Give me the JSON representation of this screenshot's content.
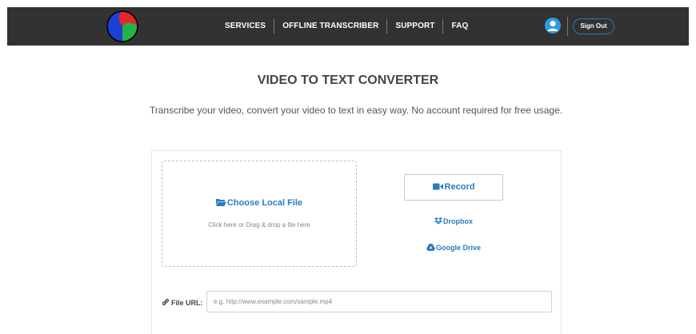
{
  "header": {
    "logo_icon": "tricolor-swirl-logo",
    "nav": [
      "SERVICES",
      "OFFLINE TRANSCRIBER",
      "SUPPORT",
      "FAQ"
    ],
    "user_icon": "user-avatar-icon",
    "signout_label": "Sign Out"
  },
  "main": {
    "title": "VIDEO TO TEXT CONVERTER",
    "subtitle": "Transcribe your video, convert your video to text in easy way. No account required for free usage."
  },
  "upload": {
    "choose_label": "Choose Local File",
    "choose_icon": "folder-open-icon",
    "drop_hint": "Click here or Drag & drop a file here",
    "record_label": "Record",
    "record_icon": "video-camera-icon",
    "dropbox_label": "Dropbox",
    "dropbox_icon": "dropbox-icon",
    "gdrive_label": "Google Drive",
    "gdrive_icon": "google-drive-icon",
    "url_label": "File URL:",
    "url_icon": "link-icon",
    "url_placeholder": "e.g. http://www.example.com/sample.mp4",
    "url_value": ""
  },
  "colors": {
    "navbar": "#323232",
    "accent": "#2b7bbf",
    "logo_red": "#e3262a",
    "logo_green": "#21b24b",
    "logo_blue": "#1c3fd6"
  }
}
